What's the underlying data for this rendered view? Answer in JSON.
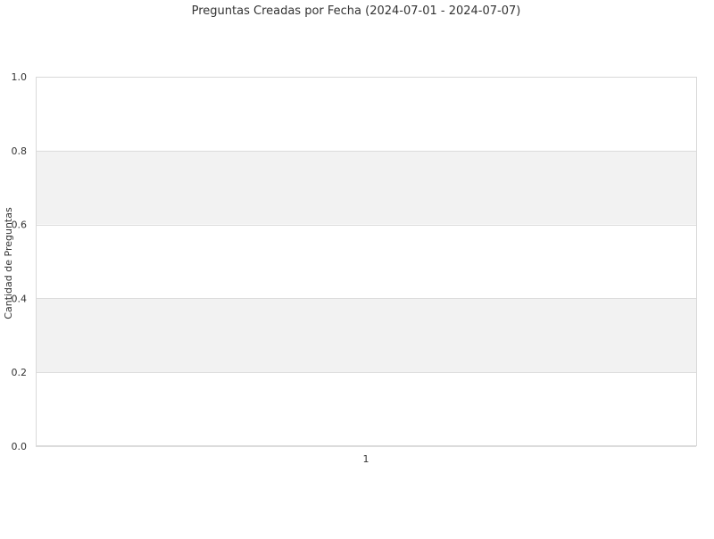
{
  "chart_data": {
    "type": "bar",
    "title": "Preguntas Creadas por Fecha (2024-07-01 - 2024-07-07)",
    "xlabel": "",
    "ylabel": "Cantidad de Preguntas",
    "categories": [
      "1"
    ],
    "series": [
      {
        "values": [
          0
        ]
      }
    ],
    "ylim": [
      0,
      1
    ],
    "yticks": [
      "0.0",
      "0.2",
      "0.4",
      "0.6",
      "0.8",
      "1.0"
    ],
    "grid": true,
    "legend": "none",
    "colors": {
      "band": "#f2f2f2",
      "grid": "#dddddd",
      "border": "#d9d9d9",
      "text": "#333333",
      "bar": "#4e79a7"
    }
  }
}
